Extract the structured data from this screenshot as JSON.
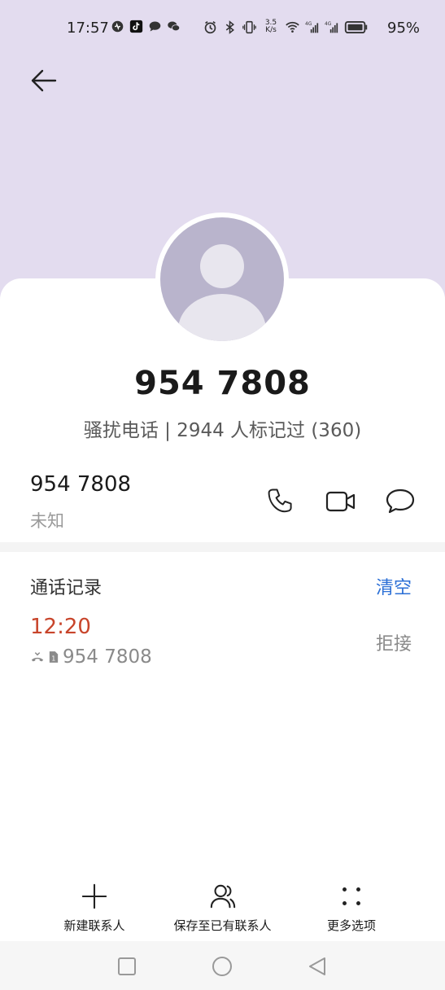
{
  "status_bar": {
    "time": "17:57",
    "net_speed_top": "3.5",
    "net_speed_bottom": "K/s",
    "battery_percent": "95%",
    "left_icons": [
      "music-icon",
      "tiktok-icon",
      "chat-bubble-icon",
      "wechat-icon"
    ],
    "right_icons": [
      "alarm-icon",
      "bluetooth-icon",
      "vibrate-icon",
      "wifi-icon",
      "signal-4g-icon",
      "signal-4g-icon",
      "battery-icon"
    ]
  },
  "header": {
    "back_icon": "arrow-left-icon",
    "background_color": "#e3dcef"
  },
  "profile": {
    "phone_number": "954 7808",
    "tag_text": "骚扰电话 | 2944 人标记过 (360)"
  },
  "contact_row": {
    "number": "954 7808",
    "label": "未知",
    "actions": [
      {
        "name": "call",
        "icon": "phone-icon"
      },
      {
        "name": "video",
        "icon": "video-camera-icon"
      },
      {
        "name": "message",
        "icon": "message-bubble-icon"
      }
    ]
  },
  "call_log": {
    "title": "通话记录",
    "clear_label": "清空",
    "entries": [
      {
        "time": "12:20",
        "number": "954 7808",
        "status": "拒接",
        "sim": "1"
      }
    ]
  },
  "bottom_actions": {
    "new_contact": "新建联系人",
    "save_existing": "保存至已有联系人",
    "more_options": "更多选项"
  },
  "colors": {
    "accent_blue": "#2b6fd6",
    "missed_red": "#c8452b",
    "avatar_gray": "#b9b4cc"
  }
}
